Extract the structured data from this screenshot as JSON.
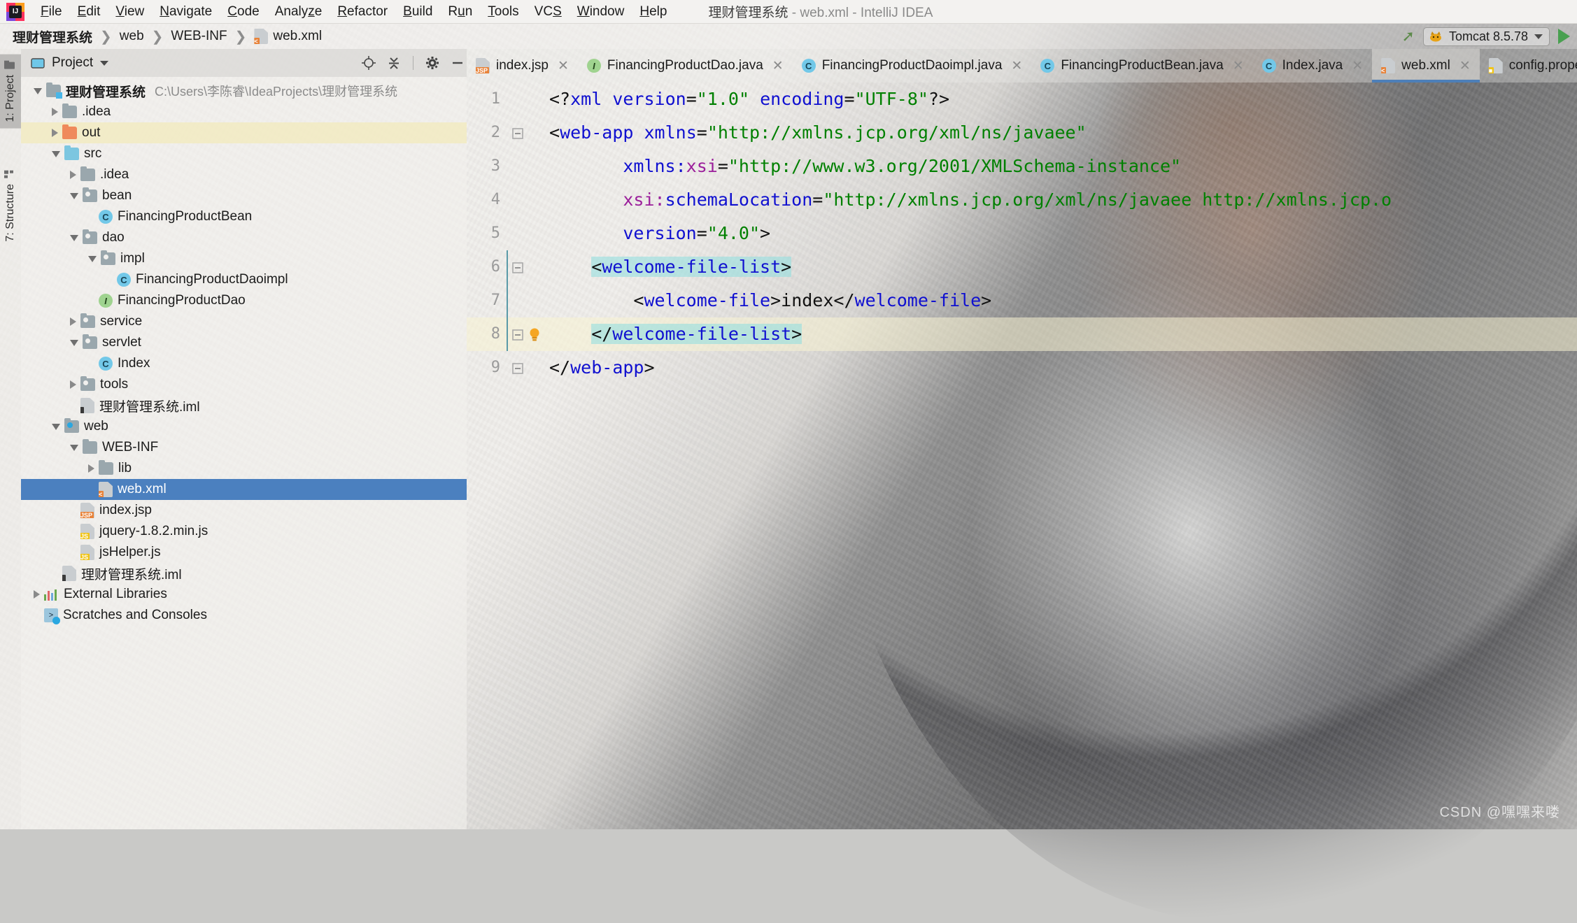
{
  "window": {
    "title_project": "理财管理系统",
    "title_sep1": " - ",
    "title_file": "web.xml",
    "title_sep2": " - ",
    "title_app": "IntelliJ IDEA",
    "logo_letter": "IJ"
  },
  "menubar": {
    "items": [
      {
        "pre": "",
        "mn": "F",
        "post": "ile"
      },
      {
        "pre": "",
        "mn": "E",
        "post": "dit"
      },
      {
        "pre": "",
        "mn": "V",
        "post": "iew"
      },
      {
        "pre": "",
        "mn": "N",
        "post": "avigate"
      },
      {
        "pre": "",
        "mn": "C",
        "post": "ode"
      },
      {
        "pre": "Analy",
        "mn": "z",
        "post": "e"
      },
      {
        "pre": "",
        "mn": "R",
        "post": "efactor"
      },
      {
        "pre": "",
        "mn": "B",
        "post": "uild"
      },
      {
        "pre": "R",
        "mn": "u",
        "post": "n"
      },
      {
        "pre": "",
        "mn": "T",
        "post": "ools"
      },
      {
        "pre": "VC",
        "mn": "S",
        "post": ""
      },
      {
        "pre": "",
        "mn": "W",
        "post": "indow"
      },
      {
        "pre": "",
        "mn": "H",
        "post": "elp"
      }
    ]
  },
  "breadcrumb": {
    "items": [
      {
        "label": "理财管理系统",
        "icon": "",
        "bold": true
      },
      {
        "label": "web",
        "icon": "",
        "bold": false
      },
      {
        "label": "WEB-INF",
        "icon": "",
        "bold": false
      },
      {
        "label": "web.xml",
        "icon": "xml-file-icon",
        "bold": false
      }
    ],
    "separator": "❯"
  },
  "toolbar": {
    "build_icon": "hammer-icon",
    "run_config_name": "Tomcat 8.5.78",
    "run_config_icon": "tomcat-cat-icon",
    "run_button": "run-icon"
  },
  "left_stripe": {
    "buttons": [
      {
        "label": "1: Project",
        "icon": "project-folder-icon",
        "active": true
      },
      {
        "label": "7: Structure",
        "icon": "structure-icon",
        "active": false
      }
    ]
  },
  "project_panel": {
    "header": {
      "title": "Project",
      "icons": [
        "locate-icon",
        "collapse-all-icon",
        "gear-icon",
        "minimize-icon"
      ]
    },
    "tree": [
      {
        "indent": 0,
        "arrow": "open",
        "icon": "folder-module-root",
        "label": "理财管理系统",
        "bold": true,
        "path": "C:\\Users\\李陈睿\\IdeaProjects\\理财管理系统",
        "state": "normal"
      },
      {
        "indent": 1,
        "arrow": "closed",
        "icon": "folder",
        "label": ".idea",
        "bold": false,
        "path": "",
        "state": "normal"
      },
      {
        "indent": 1,
        "arrow": "closed",
        "icon": "folder-out",
        "label": "out",
        "bold": false,
        "path": "",
        "state": "highlight"
      },
      {
        "indent": 1,
        "arrow": "open",
        "icon": "folder-src",
        "label": "src",
        "bold": false,
        "path": "",
        "state": "normal"
      },
      {
        "indent": 2,
        "arrow": "closed",
        "icon": "folder",
        "label": ".idea",
        "bold": false,
        "path": "",
        "state": "normal"
      },
      {
        "indent": 2,
        "arrow": "open",
        "icon": "folder-package",
        "label": "bean",
        "bold": false,
        "path": "",
        "state": "normal"
      },
      {
        "indent": 3,
        "arrow": "none",
        "icon": "java-class",
        "label": "FinancingProductBean",
        "bold": false,
        "path": "",
        "state": "normal"
      },
      {
        "indent": 2,
        "arrow": "open",
        "icon": "folder-package",
        "label": "dao",
        "bold": false,
        "path": "",
        "state": "normal"
      },
      {
        "indent": 3,
        "arrow": "open",
        "icon": "folder-package",
        "label": "impl",
        "bold": false,
        "path": "",
        "state": "normal"
      },
      {
        "indent": 4,
        "arrow": "none",
        "icon": "java-class",
        "label": "FinancingProductDaoimpl",
        "bold": false,
        "path": "",
        "state": "normal"
      },
      {
        "indent": 3,
        "arrow": "none",
        "icon": "java-interface",
        "label": "FinancingProductDao",
        "bold": false,
        "path": "",
        "state": "normal"
      },
      {
        "indent": 2,
        "arrow": "closed",
        "icon": "folder-package",
        "label": "service",
        "bold": false,
        "path": "",
        "state": "normal"
      },
      {
        "indent": 2,
        "arrow": "open",
        "icon": "folder-package",
        "label": "servlet",
        "bold": false,
        "path": "",
        "state": "normal"
      },
      {
        "indent": 3,
        "arrow": "none",
        "icon": "java-class",
        "label": "Index",
        "bold": false,
        "path": "",
        "state": "normal"
      },
      {
        "indent": 2,
        "arrow": "closed",
        "icon": "folder-package",
        "label": "tools",
        "bold": false,
        "path": "",
        "state": "normal"
      },
      {
        "indent": 2,
        "arrow": "none",
        "icon": "iml-file",
        "label": "理财管理系统.iml",
        "bold": false,
        "path": "",
        "state": "normal"
      },
      {
        "indent": 1,
        "arrow": "open",
        "icon": "folder-webroot",
        "label": "web",
        "bold": false,
        "path": "",
        "state": "normal"
      },
      {
        "indent": 2,
        "arrow": "open",
        "icon": "folder",
        "label": "WEB-INF",
        "bold": false,
        "path": "",
        "state": "normal"
      },
      {
        "indent": 3,
        "arrow": "closed",
        "icon": "folder",
        "label": "lib",
        "bold": false,
        "path": "",
        "state": "normal"
      },
      {
        "indent": 3,
        "arrow": "none",
        "icon": "xml-file",
        "label": "web.xml",
        "bold": false,
        "path": "",
        "state": "selected"
      },
      {
        "indent": 2,
        "arrow": "none",
        "icon": "jsp-file",
        "label": "index.jsp",
        "bold": false,
        "path": "",
        "state": "normal"
      },
      {
        "indent": 2,
        "arrow": "none",
        "icon": "js-min-file",
        "label": "jquery-1.8.2.min.js",
        "bold": false,
        "path": "",
        "state": "normal"
      },
      {
        "indent": 2,
        "arrow": "none",
        "icon": "js-file",
        "label": "jsHelper.js",
        "bold": false,
        "path": "",
        "state": "normal"
      },
      {
        "indent": 1,
        "arrow": "none",
        "icon": "iml-file",
        "label": "理财管理系统.iml",
        "bold": false,
        "path": "",
        "state": "normal"
      },
      {
        "indent": 0,
        "arrow": "closed",
        "icon": "external-libraries",
        "label": "External Libraries",
        "bold": false,
        "path": "",
        "state": "normal"
      },
      {
        "indent": 0,
        "arrow": "none",
        "icon": "scratches",
        "label": "Scratches and Consoles",
        "bold": false,
        "path": "",
        "state": "normal"
      }
    ]
  },
  "editor": {
    "tabs": [
      {
        "label": "index.jsp",
        "icon": "jsp-file-icon",
        "active": false,
        "closable": true
      },
      {
        "label": "FinancingProductDao.java",
        "icon": "java-interface-icon",
        "active": false,
        "closable": true
      },
      {
        "label": "FinancingProductDaoimpl.java",
        "icon": "java-class-icon",
        "active": false,
        "closable": true
      },
      {
        "label": "FinancingProductBean.java",
        "icon": "java-class-icon",
        "active": false,
        "closable": true
      },
      {
        "label": "Index.java",
        "icon": "java-class-icon",
        "active": false,
        "closable": true
      },
      {
        "label": "web.xml",
        "icon": "xml-file-icon",
        "active": true,
        "closable": true
      },
      {
        "label": "config.properties",
        "icon": "properties-file-icon",
        "active": false,
        "closable": false
      }
    ],
    "lines": [
      {
        "n": "1",
        "fold": "",
        "bulb": false,
        "caret": false,
        "leftmark": false,
        "parts": [
          {
            "t": "punct",
            "s": "<?"
          },
          {
            "t": "tag",
            "s": "xml"
          },
          {
            "t": "punct",
            "s": " "
          },
          {
            "t": "attr",
            "s": "version"
          },
          {
            "t": "punct",
            "s": "="
          },
          {
            "t": "str",
            "s": "\"1.0\""
          },
          {
            "t": "punct",
            "s": " "
          },
          {
            "t": "attr",
            "s": "encoding"
          },
          {
            "t": "punct",
            "s": "="
          },
          {
            "t": "str",
            "s": "\"UTF-8\""
          },
          {
            "t": "punct",
            "s": "?>"
          }
        ]
      },
      {
        "n": "2",
        "fold": "-",
        "bulb": false,
        "caret": false,
        "leftmark": false,
        "parts": [
          {
            "t": "punct",
            "s": "<"
          },
          {
            "t": "tag",
            "s": "web-app"
          },
          {
            "t": "punct",
            "s": " "
          },
          {
            "t": "attr",
            "s": "xmlns"
          },
          {
            "t": "punct",
            "s": "="
          },
          {
            "t": "str",
            "s": "\"http://xmlns.jcp.org/xml/ns/javaee\""
          }
        ]
      },
      {
        "n": "3",
        "fold": "",
        "bulb": false,
        "caret": false,
        "leftmark": false,
        "indent": 7,
        "parts": [
          {
            "t": "attr",
            "s": "xmlns:"
          },
          {
            "t": "ns",
            "s": "xsi"
          },
          {
            "t": "punct",
            "s": "="
          },
          {
            "t": "str",
            "s": "\"http://www.w3.org/2001/XMLSchema-instance\""
          }
        ]
      },
      {
        "n": "4",
        "fold": "",
        "bulb": false,
        "caret": false,
        "leftmark": false,
        "indent": 7,
        "parts": [
          {
            "t": "ns",
            "s": "xsi:"
          },
          {
            "t": "attr",
            "s": "schemaLocation"
          },
          {
            "t": "punct",
            "s": "="
          },
          {
            "t": "str",
            "s": "\"http://xmlns.jcp.org/xml/ns/javaee http://xmlns.jcp.o"
          }
        ]
      },
      {
        "n": "5",
        "fold": "",
        "bulb": false,
        "caret": false,
        "leftmark": false,
        "indent": 7,
        "parts": [
          {
            "t": "attr",
            "s": "version"
          },
          {
            "t": "punct",
            "s": "="
          },
          {
            "t": "str",
            "s": "\"4.0\""
          },
          {
            "t": "punct",
            "s": ">"
          }
        ]
      },
      {
        "n": "6",
        "fold": "-",
        "bulb": false,
        "caret": false,
        "leftmark": true,
        "indent": 4,
        "match": true,
        "parts": [
          {
            "t": "punct",
            "s": "<"
          },
          {
            "t": "tag",
            "s": "welcome-file-list"
          },
          {
            "t": "punct",
            "s": ">"
          }
        ]
      },
      {
        "n": "7",
        "fold": "",
        "bulb": false,
        "caret": false,
        "leftmark": true,
        "indent": 8,
        "parts": [
          {
            "t": "punct",
            "s": "<"
          },
          {
            "t": "tag",
            "s": "welcome-file"
          },
          {
            "t": "punct",
            "s": ">"
          },
          {
            "t": "text",
            "s": "index"
          },
          {
            "t": "punct",
            "s": "</"
          },
          {
            "t": "tag",
            "s": "welcome-file"
          },
          {
            "t": "punct",
            "s": ">"
          }
        ]
      },
      {
        "n": "8",
        "fold": "-",
        "bulb": true,
        "caret": true,
        "leftmark": true,
        "indent": 4,
        "match": true,
        "parts": [
          {
            "t": "punct",
            "s": "</"
          },
          {
            "t": "tag",
            "s": "welcome-file-list"
          },
          {
            "t": "punct",
            "s": ">"
          }
        ]
      },
      {
        "n": "9",
        "fold": "-",
        "bulb": false,
        "caret": false,
        "leftmark": false,
        "parts": [
          {
            "t": "punct",
            "s": "</"
          },
          {
            "t": "tag",
            "s": "web-app"
          },
          {
            "t": "punct",
            "s": ">"
          }
        ]
      }
    ]
  },
  "watermark": {
    "text": "CSDN @嘿嘿来喽"
  }
}
